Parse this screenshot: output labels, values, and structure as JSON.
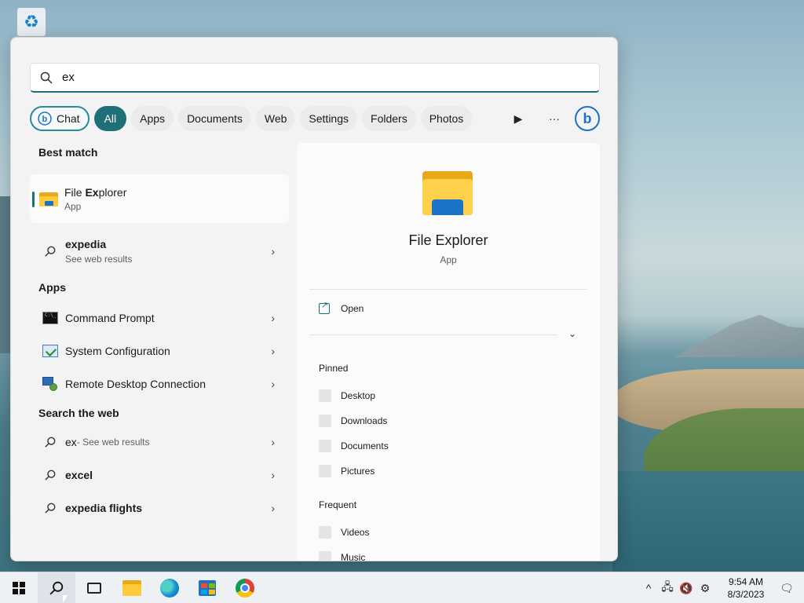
{
  "desktop": {
    "recycle_bin_icon": "recycle-bin-icon"
  },
  "search": {
    "query": "ex",
    "filters": [
      "All",
      "Apps",
      "Documents",
      "Web",
      "Settings",
      "Folders",
      "Photos"
    ],
    "chat_label": "Chat"
  },
  "left": {
    "best_match_title": "Best match",
    "best_match": {
      "name_prefix": "File ",
      "name_bold": "Ex",
      "name_suffix": "plorer",
      "type": "App"
    },
    "web_suggestion": {
      "label": "expedia",
      "sub": "See web results"
    },
    "apps_title": "Apps",
    "apps": [
      "Command Prompt",
      "System Configuration",
      "Remote Desktop Connection"
    ],
    "search_web_title": "Search the web",
    "web_results": [
      {
        "label": "ex",
        "sub": " - See web results"
      },
      {
        "label": "excel"
      },
      {
        "label": "expedia flights"
      }
    ]
  },
  "detail": {
    "title": "File Explorer",
    "subtitle": "App",
    "open_label": "Open",
    "pinned_title": "Pinned",
    "pinned": [
      "Desktop",
      "Downloads",
      "Documents",
      "Pictures"
    ],
    "frequent_title": "Frequent",
    "frequent": [
      "Videos",
      "Music"
    ]
  },
  "taskbar": {
    "time": "9:54 AM",
    "date": "8/3/2023",
    "apps": [
      "start-icon",
      "search-icon",
      "task-view-icon",
      "file-explorer-icon",
      "edge-icon",
      "store-icon",
      "chrome-icon"
    ]
  },
  "colors": {
    "accent": "#1f6f78",
    "bing_blue": "#1b72c8"
  }
}
